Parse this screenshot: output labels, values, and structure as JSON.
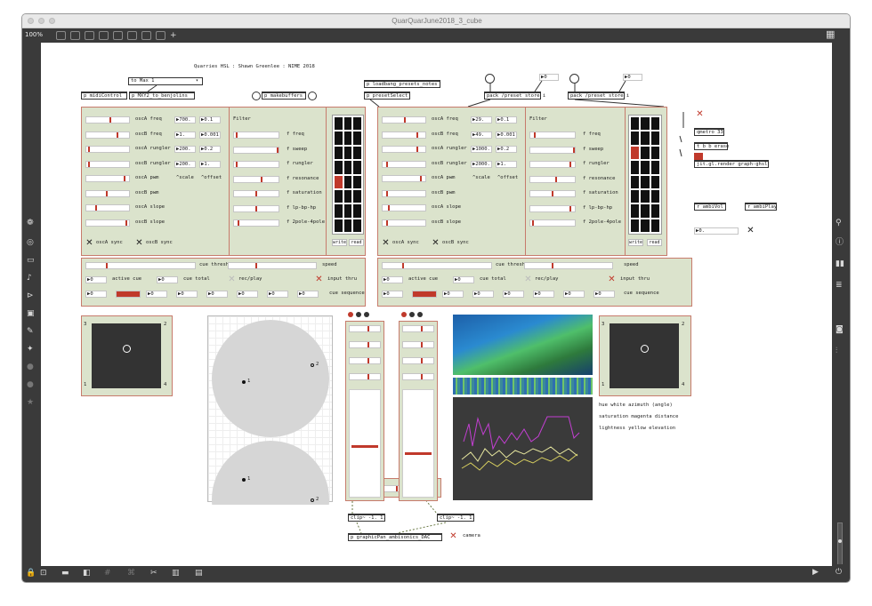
{
  "window": {
    "title": "QuarQuarJune2018_3_cube",
    "zoom": "100%"
  },
  "header": {
    "credit": "Quarries HSL : Shawn Greenlee : NIME 2018"
  },
  "objects": {
    "midicontrol": "p midiControl",
    "max_menu": "to Max 1",
    "mxy": "p MXY2_to_benjolins",
    "makebuffers": "p makebuffers",
    "loadbang": "p loadbang_presets_notes",
    "presetselect": "p presetSelect",
    "pack1": "pack /preset store i",
    "pack2": "pack /preset store i",
    "num1": "0",
    "num2": "0",
    "qmetro": "qmetro 33",
    "tbberase": "t b b erase",
    "render": "jit.gl.render graph-ghsl",
    "ambivol": "r ambiVol",
    "ambiplay": "r ambiPlay",
    "ambival": "0.",
    "clip1": "clip~ -1. 1.",
    "clip2": "clip~ -1. 1.",
    "graphicpan": "p graphicPan_ambisonics_DAC",
    "camera": "camera"
  },
  "synth": {
    "a_rows": [
      {
        "label": "oscA freq",
        "v1": "700.",
        "v2": "0.1"
      },
      {
        "label": "oscB freq",
        "v1": "1.",
        "v2": "0.001"
      },
      {
        "label": "oscA rungler",
        "v1": "200.",
        "v2": "0.2"
      },
      {
        "label": "oscB rungler",
        "v1": "200.",
        "v2": "1."
      },
      {
        "label": "oscA pwm",
        "v1": "^scale",
        "v2": "^offset"
      },
      {
        "label": "oscB pwm",
        "v1": "",
        "v2": ""
      },
      {
        "label": "oscA slope",
        "v1": "",
        "v2": ""
      },
      {
        "label": "oscB slope",
        "v1": "",
        "v2": ""
      }
    ],
    "b_rows": [
      {
        "label": "oscA freq",
        "v1": "29.",
        "v2": "0.1"
      },
      {
        "label": "oscB freq",
        "v1": "49.",
        "v2": "0.001"
      },
      {
        "label": "oscA rungler",
        "v1": "1000.",
        "v2": "0.2"
      },
      {
        "label": "oscB rungler",
        "v1": "2000.",
        "v2": "1."
      },
      {
        "label": "oscA pwm",
        "v1": "^scale",
        "v2": "^offset"
      },
      {
        "label": "oscB pwm",
        "v1": "",
        "v2": ""
      },
      {
        "label": "oscA slope",
        "v1": "",
        "v2": ""
      },
      {
        "label": "oscB slope",
        "v1": "",
        "v2": ""
      }
    ],
    "filter_title": "Filter",
    "filter_rows": [
      "f freq",
      "f sweep",
      "f rungler",
      "f resonance",
      "f saturation",
      "f lp-bp-hp",
      "f 2pole-4pole"
    ],
    "sync_a": "oscA sync",
    "sync_b": "oscB sync",
    "write": "write",
    "read": "read"
  },
  "cue": {
    "thresh": "cue thresh",
    "speed": "speed",
    "active": "active cue",
    "total": "cue total",
    "recplay": "rec/play",
    "input": "input thru",
    "sequence": "cue sequence",
    "zero": "0"
  },
  "xy": {
    "c1": "1",
    "c2": "2",
    "c3": "3",
    "c4": "4"
  },
  "pan": {
    "p1": "1",
    "p2": "2"
  },
  "legend": {
    "line1": "hue white azimuth (angle)",
    "line2": "saturation magenta distance",
    "line3": "lightness yellow elevation"
  }
}
